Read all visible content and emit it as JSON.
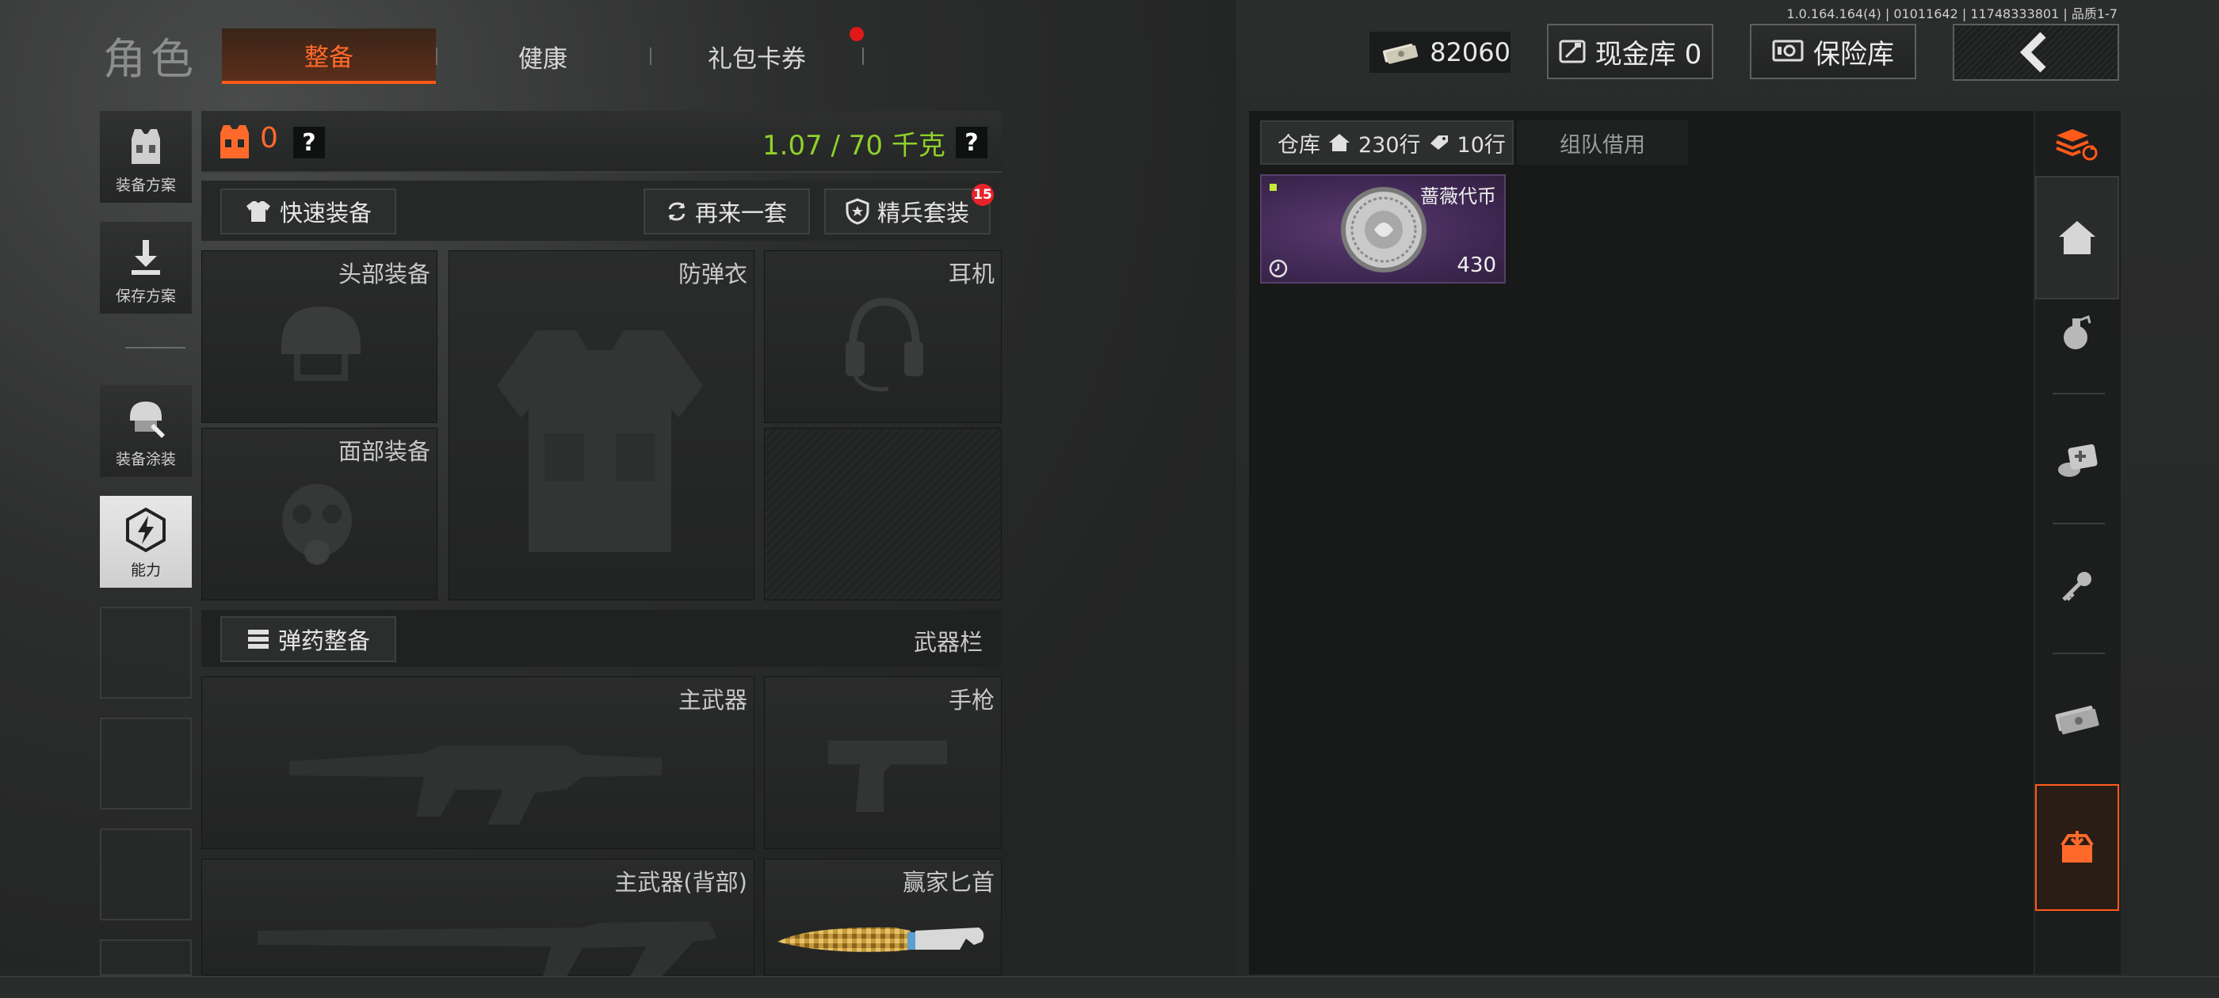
{
  "version": "1.0.164.164(4) | 01011642 | 11748333801 | 品质1-7",
  "page_title": "角色",
  "tabs": [
    {
      "label": "整备",
      "active": true
    },
    {
      "label": "健康",
      "active": false
    },
    {
      "label": "礼包卡券",
      "active": false,
      "badge_dot": true
    }
  ],
  "currency": {
    "icon": "cash-icon",
    "value": "82060"
  },
  "top_buttons": {
    "cash_vault": "现金库 0",
    "safe_box": "保险库",
    "back_icon": "chevron-left-icon"
  },
  "sidebar": [
    {
      "label": "装备方案",
      "icon": "vest-icon"
    },
    {
      "label": "保存方案",
      "icon": "download-icon"
    },
    {
      "label": "装备涂装",
      "icon": "helmet-paint-icon"
    },
    {
      "label": "能力",
      "icon": "ability-icon",
      "active": true
    }
  ],
  "equip_header": {
    "armor_count": "0",
    "help": "?",
    "weight": "1.07 / 70 千克",
    "weight_color": "#8fd12a",
    "armor_color": "#ff6a2a"
  },
  "actions": {
    "quick_equip": "快速装备",
    "again": "再来一套",
    "elite": "精兵套装",
    "elite_badge": "15"
  },
  "slots": {
    "head": "头部装备",
    "armor": "防弹衣",
    "headset": "耳机",
    "face": "面部装备",
    "primary": "主武器",
    "pistol": "手枪",
    "primary_back": "主武器(背部)",
    "knife": "赢家匕首"
  },
  "ammo": {
    "button": "弹药整备",
    "weapon_bar": "武器栏"
  },
  "warehouse": {
    "tab_label": "仓库",
    "rows_home": "230行",
    "rows_ticket": "10行",
    "team_tab": "组队借用",
    "item": {
      "name": "蔷薇代币",
      "count": "430",
      "color": "#3c2650"
    }
  },
  "right_rail": [
    "layers-refresh-icon",
    "home-icon",
    "grenade-icon",
    "medkit-icon",
    "key-icon",
    "money-icon",
    "loot-box-icon"
  ],
  "accent": "#ff5a1a"
}
